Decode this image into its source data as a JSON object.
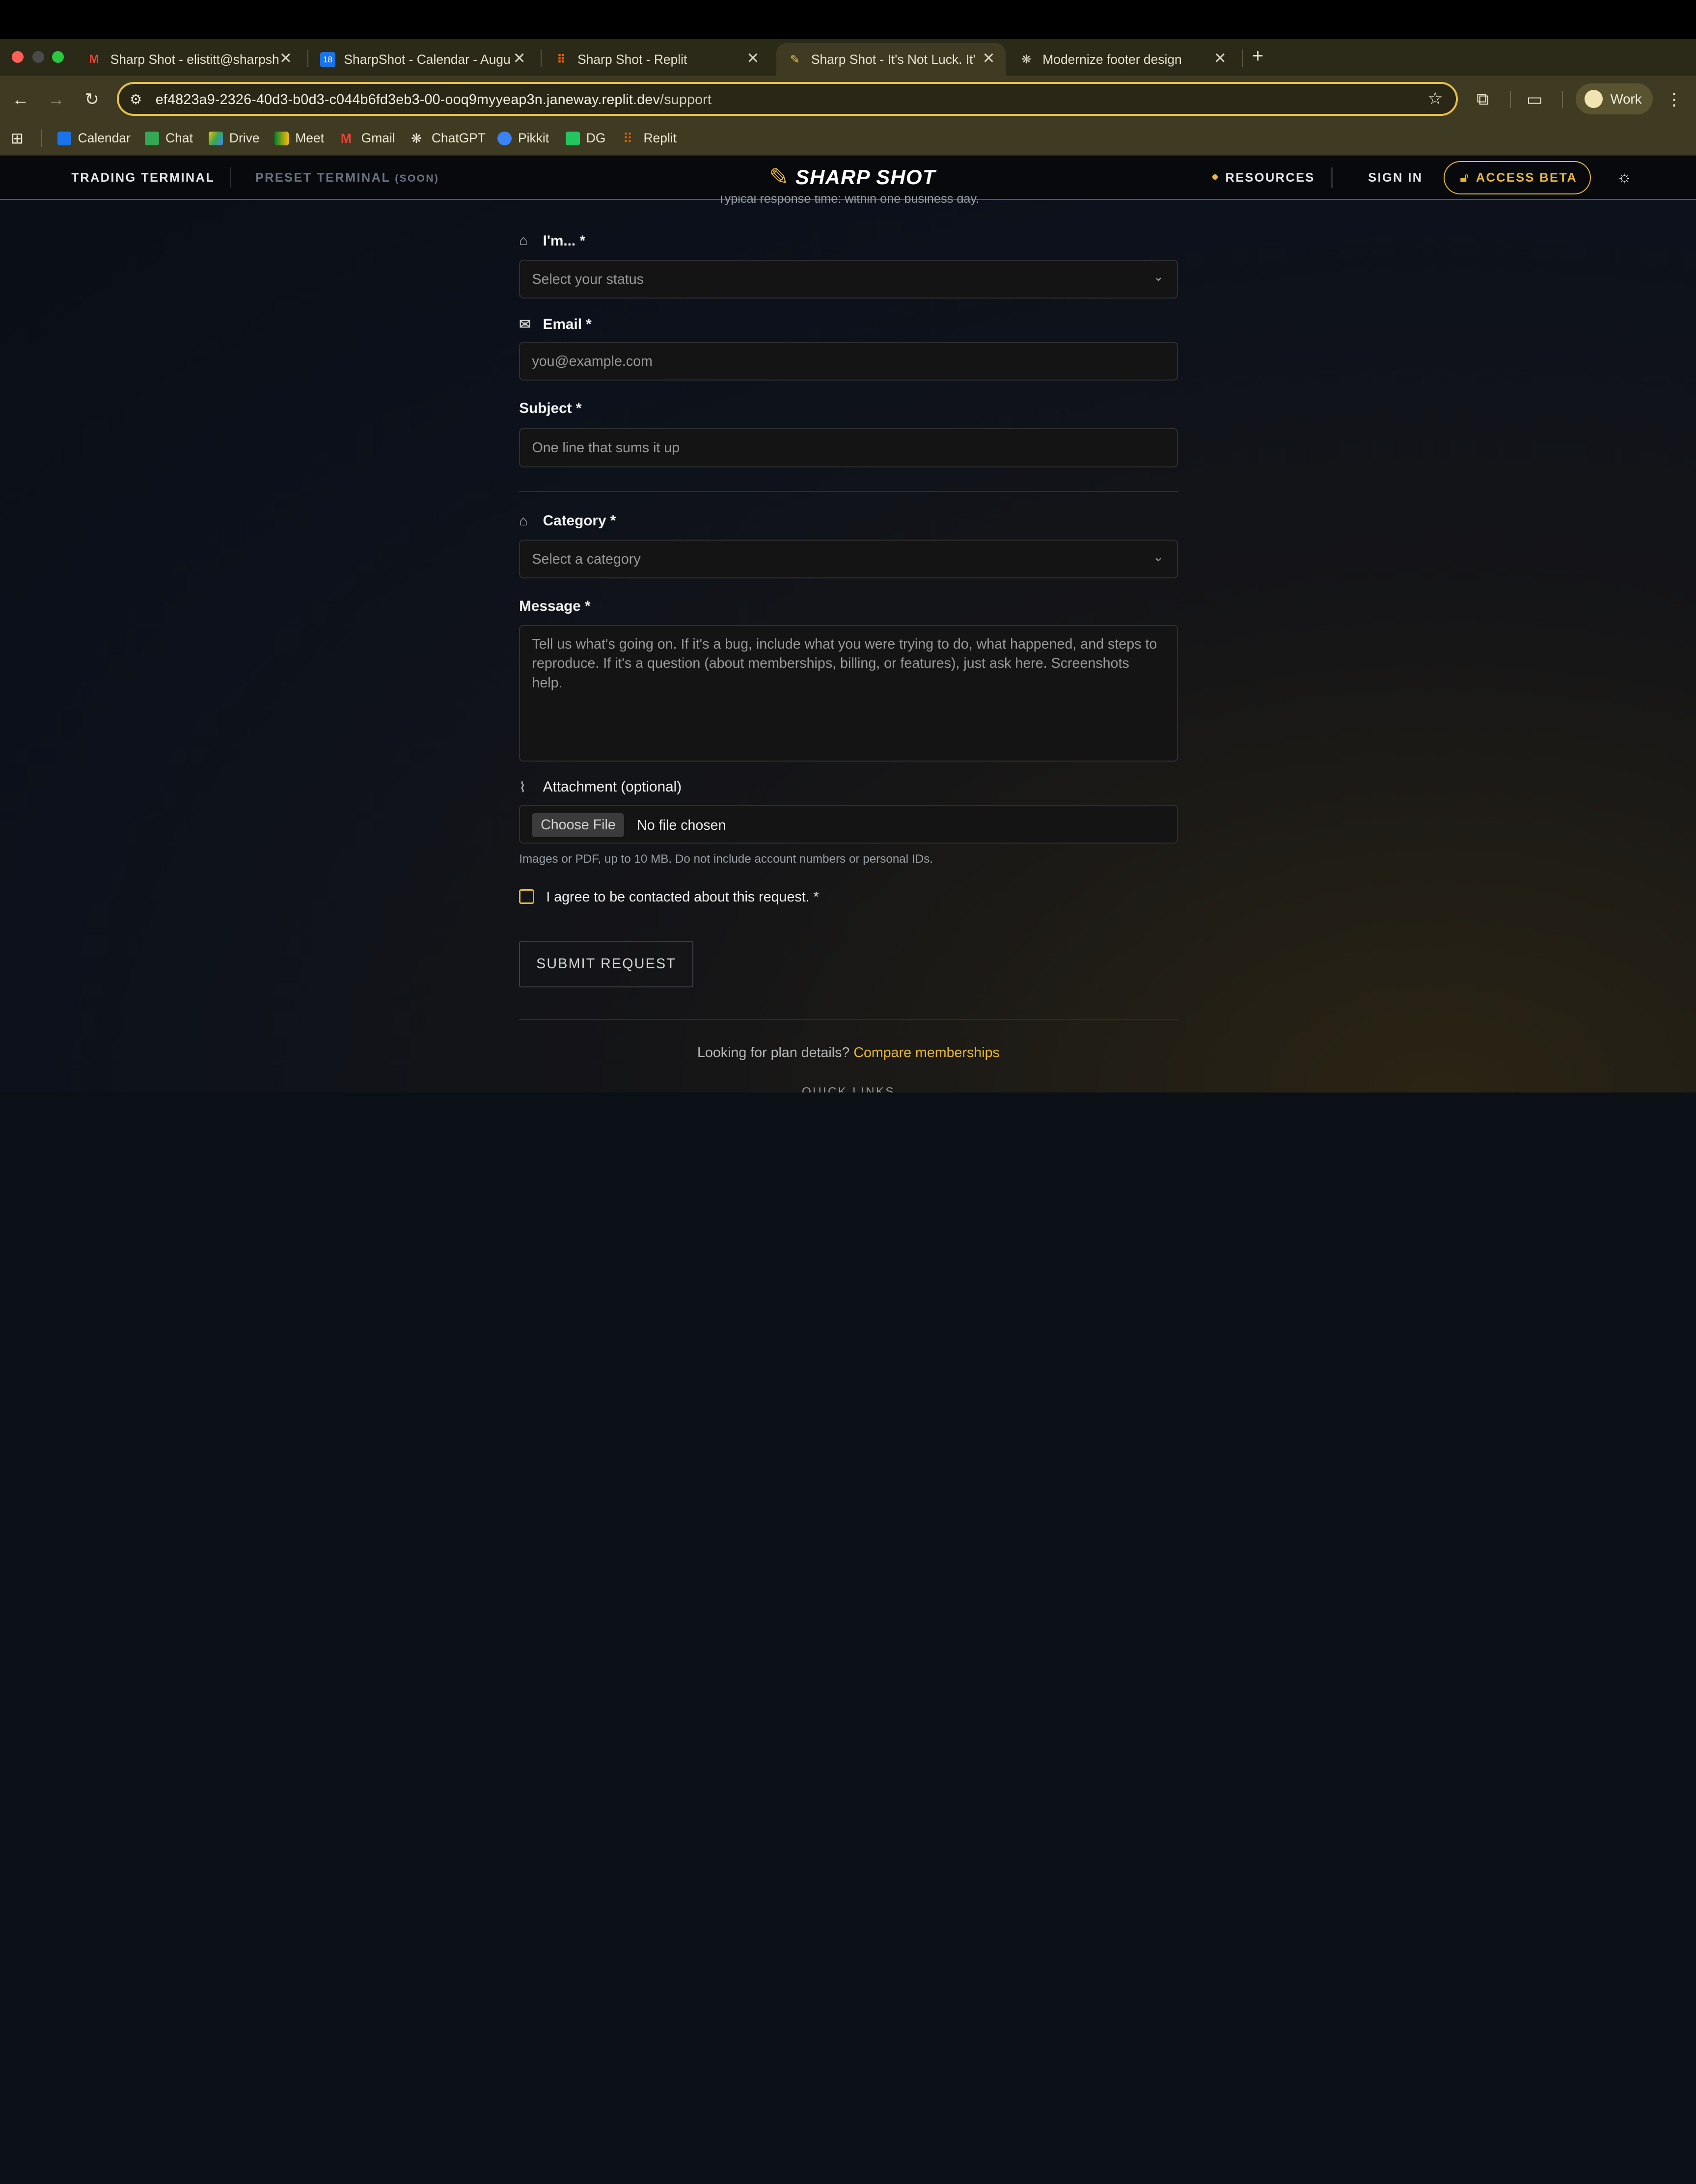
{
  "browser": {
    "tabs": [
      {
        "title": "Sharp Shot - elistitt@sharpsh",
        "icon": "gmail-icon"
      },
      {
        "title": "SharpShot - Calendar - Augu",
        "icon": "calendar-icon"
      },
      {
        "title": "Sharp Shot - Replit",
        "icon": "replit-icon"
      },
      {
        "title": "Sharp Shot - It's Not Luck. It'",
        "icon": "sharpshot-icon",
        "active": true
      },
      {
        "title": "Modernize footer design",
        "icon": "chatgpt-icon"
      }
    ],
    "url": {
      "host": "ef4823a9-2326-40d3-b0d3-c044b6fd3eb3-00-ooq9myyeap3n.janeway.replit.dev",
      "path": "/support"
    },
    "profile_label": "Work",
    "bookmarks": [
      "Calendar",
      "Chat",
      "Drive",
      "Meet",
      "Gmail",
      "ChatGPT",
      "Pikkit",
      "DG",
      "Replit"
    ]
  },
  "site_header": {
    "trading_terminal": "TRADING TERMINAL",
    "preset_terminal": "PRESET TERMINAL",
    "preset_soon": "(SOON)",
    "brand": "SHARP SHOT",
    "resources": "RESOURCES",
    "sign_in": "SIGN IN",
    "access_beta": "ACCESS BETA"
  },
  "form": {
    "response_time": "Typical response time: within one business day.",
    "status_label": "I'm... *",
    "status_placeholder": "Select your status",
    "email_label": "Email *",
    "email_placeholder": "you@example.com",
    "subject_label": "Subject *",
    "subject_placeholder": "One line that sums it up",
    "category_label": "Category *",
    "category_placeholder": "Select a category",
    "message_label": "Message *",
    "message_placeholder": "Tell us what's going on. If it's a bug, include what you were trying to do, what happened, and steps to reproduce. If it's a question (about memberships, billing, or features), just ask here. Screenshots help.",
    "attachment_label": "Attachment (optional)",
    "choose_file": "Choose File",
    "no_file": "No file chosen",
    "attachment_hint": "Images or PDF, up to 10 MB. Do not include account numbers or personal IDs.",
    "consent_label": "I agree to be contacted about this request. *",
    "submit": "SUBMIT REQUEST"
  },
  "footer": {
    "plan_text": "Looking for plan details?",
    "plan_link": "Compare memberships",
    "quick_links": "QUICK LINKS"
  },
  "colors": {
    "accent": "#e8b83a",
    "page_bg": "#0b0f16",
    "field_bg": "#141414"
  }
}
